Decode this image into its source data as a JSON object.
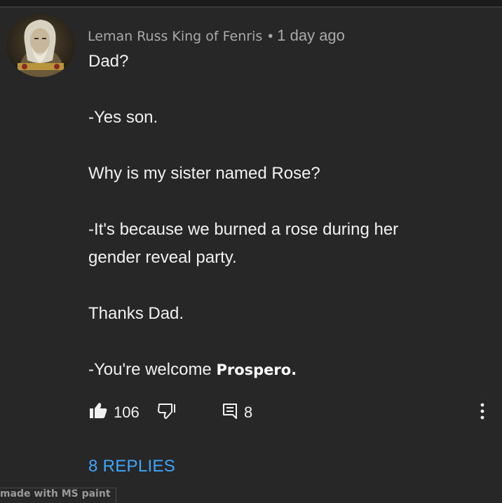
{
  "comment": {
    "author": "Leman Russ King of Fenris",
    "separator": "•",
    "timestamp": "1 day ago",
    "lines": [
      "Dad?",
      "-Yes son.",
      "Why is my sister named Rose?",
      "-It's because we burned a rose during her",
      "gender reveal party.",
      "Thanks Dad."
    ],
    "last_line_prefix": "-You're welcome ",
    "last_line_name": "Prospero."
  },
  "actions": {
    "like_count": "106",
    "reply_count": "8",
    "like_icon": "thumbs-up-icon",
    "dislike_icon": "thumbs-down-icon",
    "reply_icon": "comment-icon",
    "menu_icon": "more-vertical-icon"
  },
  "replies": {
    "label": "8 REPLIES"
  },
  "watermark": {
    "text": "made with MS paint"
  },
  "colors": {
    "background": "#272727",
    "text": "#f1f1f1",
    "muted": "#aaaaaa",
    "link": "#3ea6ff"
  }
}
